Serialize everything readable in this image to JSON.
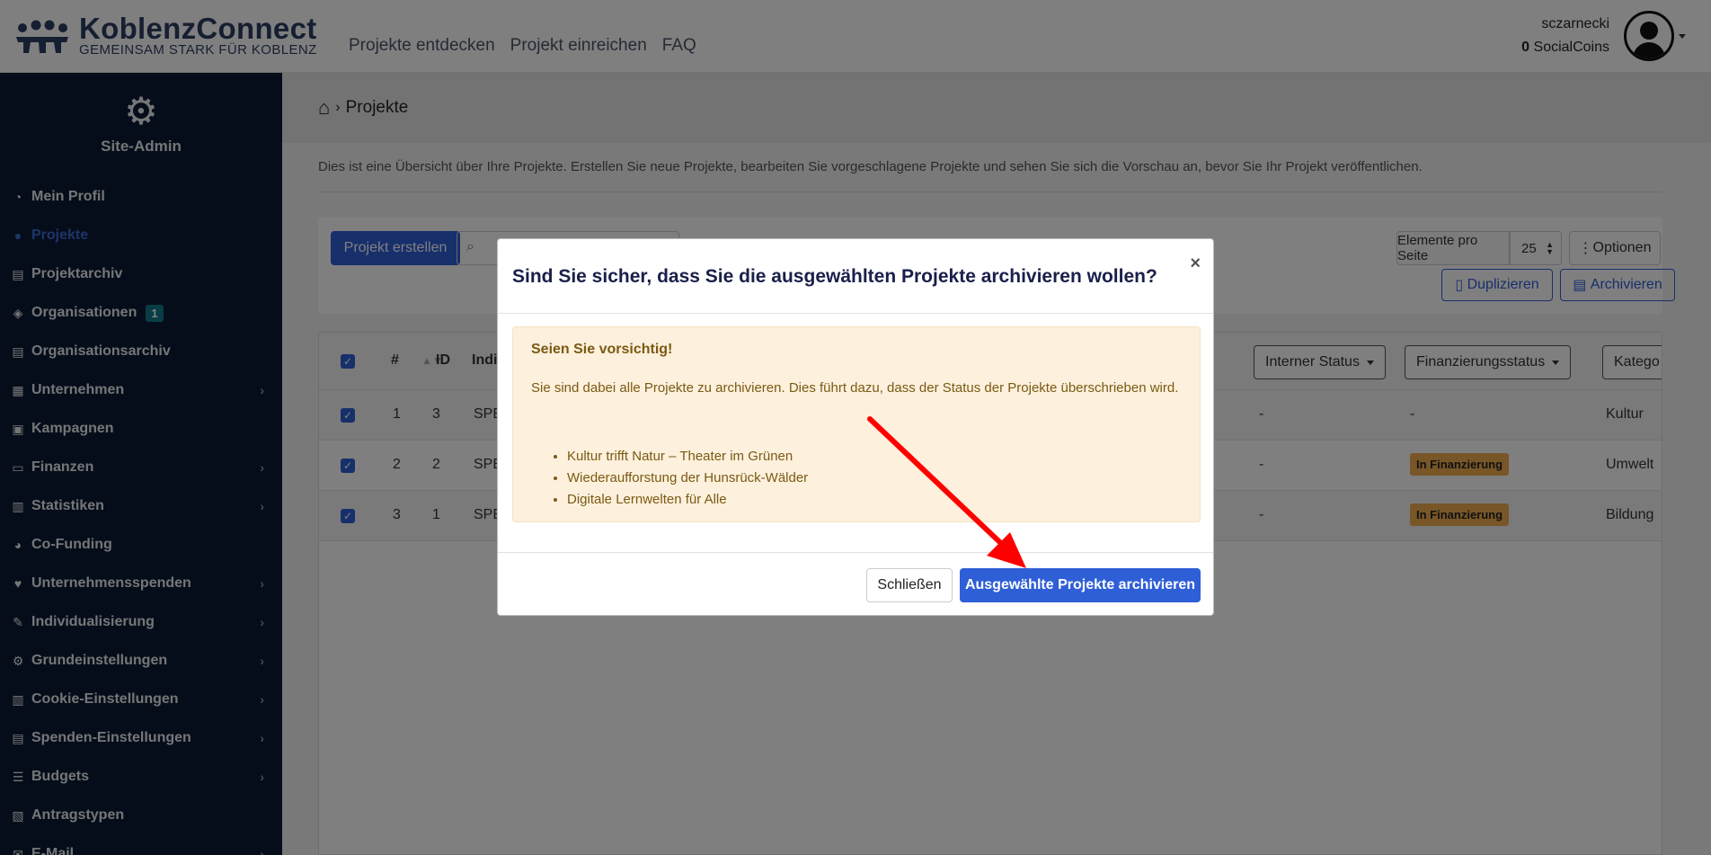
{
  "brand": {
    "title": "KoblenzConnect",
    "subtitle": "GEMEINSAM STARK FÜR KOBLENZ"
  },
  "topnav": [
    "Projekte entdecken",
    "Projekt einreichen",
    "FAQ"
  ],
  "user": {
    "name": "sczarnecki",
    "coins_value": "0",
    "coins_label": "SocialCoins"
  },
  "sidebar": {
    "title": "Site-Admin",
    "items": [
      {
        "label": "Mein Profil",
        "icon": "gauge-icon"
      },
      {
        "label": "Projekte",
        "icon": "map-pin-icon"
      },
      {
        "label": "Projektarchiv",
        "icon": "archive-icon"
      },
      {
        "label": "Organisationen",
        "icon": "shield-icon",
        "badge": "1"
      },
      {
        "label": "Organisationsarchiv",
        "icon": "archive-icon"
      },
      {
        "label": "Unternehmen",
        "icon": "building-icon"
      },
      {
        "label": "Kampagnen",
        "icon": "grid-icon"
      },
      {
        "label": "Finanzen",
        "icon": "money-icon"
      },
      {
        "label": "Statistiken",
        "icon": "chart-icon"
      },
      {
        "label": "Co-Funding",
        "icon": "pie-icon"
      },
      {
        "label": "Unternehmensspenden",
        "icon": "hand-icon"
      },
      {
        "label": "Individualisierung",
        "icon": "magic-icon"
      },
      {
        "label": "Grundeinstellungen",
        "icon": "gears-icon"
      },
      {
        "label": "Cookie-Einstellungen",
        "icon": "chart-icon"
      },
      {
        "label": "Spenden-Einstellungen",
        "icon": "archive-icon"
      },
      {
        "label": "Budgets",
        "icon": "list-icon"
      },
      {
        "label": "Antragstypen",
        "icon": "file-icon"
      },
      {
        "label": "E-Mail",
        "icon": "mail-icon"
      }
    ]
  },
  "breadcrumb": {
    "current": "Projekte"
  },
  "intro": "Dies ist eine Übersicht über Ihre Projekte. Erstellen Sie neue Projekte, bearbeiten Sie vorgeschlagene Projekte und sehen Sie sich die Vorschau an, bevor Sie Ihr Projekt veröffentlichen.",
  "toolbar": {
    "create": "Projekt erstellen",
    "per_page_label": "Elemente pro Seite",
    "per_page_value": "25",
    "options": "Optionen",
    "duplicate": "Duplizieren",
    "archive": "Archivieren"
  },
  "table": {
    "headers": {
      "num": "#",
      "id": "ID",
      "title": "Indi",
      "internal_status": "Interner Status",
      "funding_status": "Finanzierungsstatus",
      "category": "Katego"
    },
    "rows": [
      {
        "num": "1",
        "id": "3",
        "title": "SPE",
        "internal": "-",
        "funding": "-",
        "category": "Kultur"
      },
      {
        "num": "2",
        "id": "2",
        "title": "SPE",
        "internal": "-",
        "funding": "In Finanzierung",
        "category": "Umwelt"
      },
      {
        "num": "3",
        "id": "1",
        "title": "SPE",
        "internal": "-",
        "funding": "In Finanzierung",
        "category": "Bildung"
      }
    ]
  },
  "modal": {
    "title": "Sind Sie sicher, dass Sie die ausgewählten Projekte archivieren wollen?",
    "close_symbol": "×",
    "alert_title": "Seien Sie vorsichtig!",
    "alert_text": "Sie sind dabei alle Projekte zu archivieren. Dies führt dazu, dass der Status der Projekte überschrieben wird.",
    "projects": [
      "Kultur trifft Natur – Theater im Grünen",
      "Wiederaufforstung der Hunsrück-Wälder",
      "Digitale Lernwelten für Alle"
    ],
    "close_button": "Schließen",
    "confirm_button": "Ausgewählte Projekte archivieren"
  },
  "colors": {
    "primary": "#2f5fd6",
    "sidebar_bg": "#0d1b34",
    "warning": "#f0ad4e",
    "annotation_arrow": "#ff0000"
  }
}
